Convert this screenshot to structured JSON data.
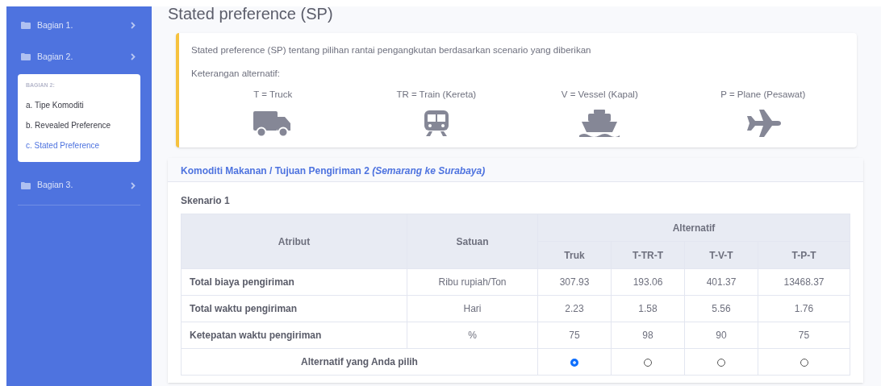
{
  "sidebar": {
    "items": [
      {
        "label": "Bagian 1."
      },
      {
        "label": "Bagian 2.",
        "submenu": {
          "heading": "BAGIAN 2:",
          "items": [
            {
              "label": "a. Tipe Komoditi",
              "selected": false
            },
            {
              "label": "b. Revealed Preference",
              "selected": false
            },
            {
              "label": "c. Stated Preference",
              "selected": true
            }
          ]
        }
      },
      {
        "label": "Bagian 3."
      }
    ]
  },
  "page_title": "Stated preference (SP)",
  "info_card": {
    "description": "Stated preference (SP) tentang pilihan rantai pengangkutan berdasarkan scenario yang diberikan",
    "legend_title": "Keterangan alternatif:",
    "modes": [
      {
        "label": "T = Truck",
        "kind": "truck"
      },
      {
        "label": "TR = Train (Kereta)",
        "kind": "train"
      },
      {
        "label": "V = Vessel (Kapal)",
        "kind": "vessel"
      },
      {
        "label": "P = Plane (Pesawat)",
        "kind": "plane"
      }
    ]
  },
  "scenario_card": {
    "header": "Komoditi Makanan / Tujuan Pengiriman 2 *(Semarang ke Surabaya)*",
    "scenario_title": "Skenario 1",
    "table": {
      "columns": {
        "attribute": "Atribut",
        "unit": "Satuan",
        "alternatives": "Alternatif",
        "options": [
          "Truk",
          "T-TR-T",
          "T-V-T",
          "T-P-T"
        ]
      },
      "rows": [
        {
          "attribute": "Total biaya pengiriman",
          "unit": "Ribu rupiah/Ton",
          "values": [
            "307.93",
            "193.06",
            "401.37",
            "13468.37"
          ]
        },
        {
          "attribute": "Total waktu pengiriman",
          "unit": "Hari",
          "values": [
            "2.23",
            "1.58",
            "5.56",
            "1.76"
          ]
        },
        {
          "attribute": "Ketepatan waktu pengiriman",
          "unit": "%",
          "values": [
            "75",
            "98",
            "90",
            "75"
          ]
        }
      ],
      "choice": {
        "label": "Alternatif yang Anda pilih",
        "options": [
          {
            "selected": true
          },
          {
            "selected": false
          },
          {
            "selected": false
          },
          {
            "selected": false
          }
        ]
      }
    }
  }
}
